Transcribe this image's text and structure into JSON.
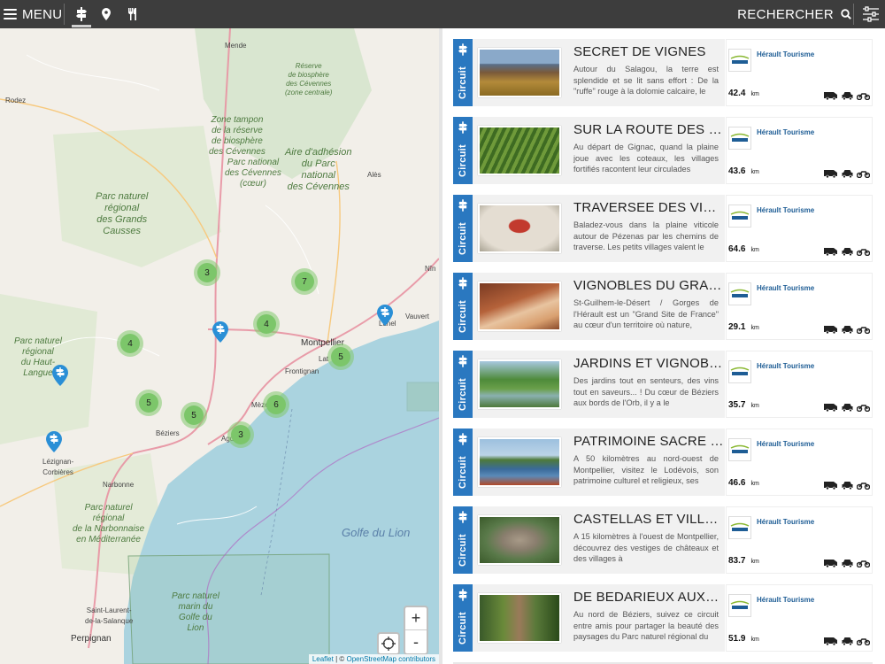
{
  "header": {
    "menu_label": "MENU",
    "search_label": "RECHERCHER",
    "nav_icons": [
      "route-icon",
      "pin-icon",
      "restaurant-icon"
    ],
    "active_nav": "route-icon"
  },
  "map": {
    "labels": {
      "mende": "Mende",
      "rodez": "Rodez",
      "ales": "Alès",
      "reserve": "Réserve\nde biosphère\ndes Cévennes\n(zone centrale)",
      "zone_tampon": "Zone tampon\nde la réserve\nde biosphère\ndes Cévennes",
      "pn_cevennes_coeur": "Parc national\ndes Cévennes\n(cœur)",
      "aire_adhesion": "Aire d'adhésion\ndu Parc\nnational\ndes Cévennes",
      "pnr_causses": "Parc naturel\nrégional\ndes Grands\nCausses",
      "pnr_haut_languedoc": "Parc naturel\nrégional\ndu Haut-\nLangue",
      "pnr_narbonnaise": "Parc naturel\nrégional\nde la Narbonnaise\nen Méditerranée",
      "parc_marin": "Parc naturel\nmarin du\nGolfe du\nLion",
      "golfe": "Golfe du Lion",
      "montpellier": "Montpellier",
      "vauvert": "Vauvert",
      "lunel": "Lunel",
      "beziers": "Béziers",
      "narbonne": "Narbonne",
      "lezignan": "Lézignan-\nCorbières",
      "st_laurent": "Saint-Laurent-\nde-la-Salanque",
      "perpignan": "Perpignan",
      "agde": "Agde",
      "meze": "Mèze",
      "frontignan": "Frontignan",
      "nimes_abbr": "Nîn",
      "lattes": "Lat"
    },
    "clusters": [
      {
        "id": "a",
        "count": "3"
      },
      {
        "id": "b",
        "count": "7"
      },
      {
        "id": "c",
        "count": "4"
      },
      {
        "id": "d",
        "count": "4"
      },
      {
        "id": "e",
        "count": "5"
      },
      {
        "id": "f",
        "count": "5"
      },
      {
        "id": "g",
        "count": "5"
      },
      {
        "id": "h",
        "count": "6"
      },
      {
        "id": "i",
        "count": "3"
      }
    ],
    "zoom_in": "+",
    "zoom_out": "-",
    "attribution_leaflet": "Leaflet",
    "attribution_sep": " | © ",
    "attribution_osm": "OpenStreetMap contributors"
  },
  "list": {
    "cards": [
      {
        "category": "Circuit",
        "title": "SECRET DE VIGNES",
        "description": "Autour du Salagou, la terre est splendide et se lit sans effort : De la \"ruffe\" rouge à la dolomie calcaire, le",
        "brand": "Hérault Tourisme",
        "distance": "42.4",
        "unit": "km"
      },
      {
        "category": "Circuit",
        "title": "SUR LA ROUTE DES …",
        "description": "Au départ de Gignac, quand la plaine joue avec les coteaux, les villages fortifiés racontent leur circulades",
        "brand": "Hérault Tourisme",
        "distance": "43.6",
        "unit": "km"
      },
      {
        "category": "Circuit",
        "title": "TRAVERSEE DES VI…",
        "description": "Baladez-vous dans la plaine viticole autour de Pézenas par les chemins de traverse. Les petits villages valent le",
        "brand": "Hérault Tourisme",
        "distance": "64.6",
        "unit": "km"
      },
      {
        "category": "Circuit",
        "title": "VIGNOBLES DU GRA…",
        "description": "St-Guilhem-le-Désert / Gorges de l'Hérault est un \"Grand Site de France\" au cœur d'un territoire où nature,",
        "brand": "Hérault Tourisme",
        "distance": "29.1",
        "unit": "km"
      },
      {
        "category": "Circuit",
        "title": "JARDINS ET VIGNOB…",
        "description": "Des jardins tout en senteurs, des vins tout en saveurs... ! Du cœur de Béziers aux bords de l'Orb, il y a le",
        "brand": "Hérault Tourisme",
        "distance": "35.7",
        "unit": "km"
      },
      {
        "category": "Circuit",
        "title": "PATRIMOINE SACRE …",
        "description": "A 50 kilomètres au nord-ouest de Montpellier, visitez le Lodévois, son patrimoine culturel et religieux, ses",
        "brand": "Hérault Tourisme",
        "distance": "46.6",
        "unit": "km"
      },
      {
        "category": "Circuit",
        "title": "CASTELLAS ET VILL…",
        "description": "A 15 kilomètres à l'ouest de Montpellier, découvrez des vestiges de châteaux et des villages à",
        "brand": "Hérault Tourisme",
        "distance": "83.7",
        "unit": "km"
      },
      {
        "category": "Circuit",
        "title": "DE BEDARIEUX AUX…",
        "description": "Au nord de Béziers, suivez ce circuit entre amis pour partager la beauté des paysages du Parc naturel régional du",
        "brand": "Hérault Tourisme",
        "distance": "51.9",
        "unit": "km"
      }
    ],
    "mode_icons": [
      "camper-van-icon",
      "car-icon",
      "motorcycle-icon"
    ]
  },
  "colors": {
    "topbar": "#3d3d3d",
    "accent_blue": "#2a78c0",
    "cluster_green": "#7cc66a",
    "sea": "#aad3df",
    "park_green": "#8fbc8f"
  }
}
